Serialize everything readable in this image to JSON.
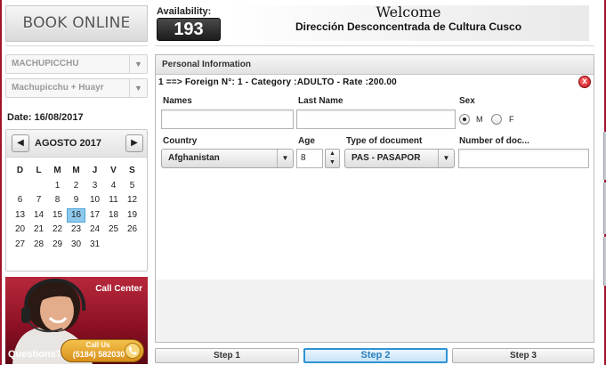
{
  "sidebar": {
    "book_online": "BOOK ONLINE",
    "site_combo": "MACHUPICCHU",
    "route_combo": "Machupicchu + Huayr",
    "date_label": "Date: 16/08/2017",
    "calendar": {
      "month_year": "AGOSTO  2017",
      "weekdays": [
        "D",
        "L",
        "M",
        "M",
        "J",
        "V",
        "S"
      ],
      "weeks": [
        [
          "",
          "",
          "1",
          "2",
          "3",
          "4",
          "5"
        ],
        [
          "6",
          "7",
          "8",
          "9",
          "10",
          "11",
          "12"
        ],
        [
          "13",
          "14",
          "15",
          "16",
          "17",
          "18",
          "19"
        ],
        [
          "20",
          "21",
          "22",
          "23",
          "24",
          "25",
          "26"
        ],
        [
          "27",
          "28",
          "29",
          "30",
          "31",
          "",
          ""
        ]
      ],
      "selected_day": "16"
    },
    "call_center": {
      "title": "Call Center",
      "questions": "Questions?",
      "call_us": "Call Us",
      "phone": "(5184) 582030"
    }
  },
  "header": {
    "availability_label": "Availability:",
    "availability_value": "193",
    "welcome": "Welcome",
    "office": "Dirección Desconcentrada de Cultura Cusco"
  },
  "form": {
    "panel_title": "Personal Information",
    "passenger_line": "1 ==> Foreign N°: 1 - Category :ADULTO - Rate :200.00",
    "close_icon": "x",
    "labels": {
      "names": "Names",
      "last_name": "Last Name",
      "sex": "Sex",
      "country": "Country",
      "age": "Age",
      "doc_type": "Type of document",
      "doc_number": "Number of doc..."
    },
    "sex_options": {
      "m": "M",
      "f": "F"
    },
    "values": {
      "names": "",
      "last_name": "",
      "country": "Afghanistan",
      "age": "8",
      "doc_type": "PAS - PASAPOR",
      "doc_number": ""
    }
  },
  "steps": {
    "step1": "Step 1",
    "step2": "Step 2",
    "step3": "Step 3"
  },
  "colors": {
    "brand_red": "#a3142b",
    "step_active": "#2f93d6",
    "calendar_selected": "#8ec9ec"
  }
}
